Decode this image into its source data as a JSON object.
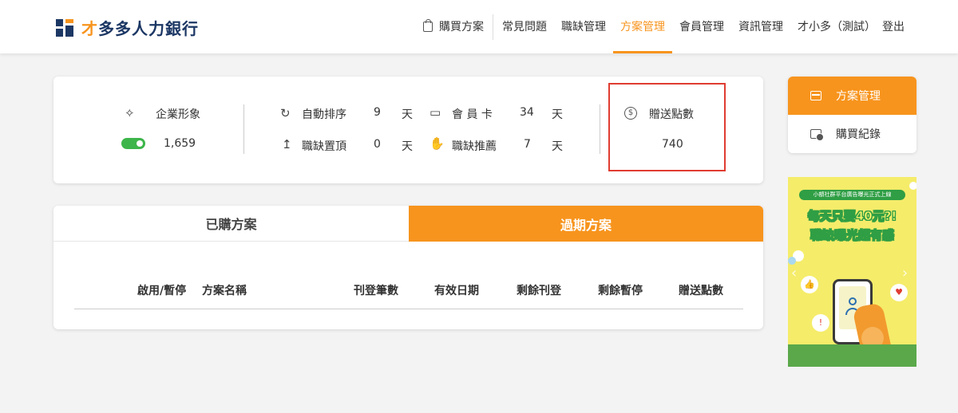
{
  "brand": {
    "logo_first": "才",
    "logo_rest": "多多人力銀行"
  },
  "nav": {
    "buy_plan": "購買方案",
    "faq": "常見問題",
    "jobs": "職缺管理",
    "plans": "方案管理",
    "members": "會員管理",
    "info": "資訊管理",
    "user": "才小多（測試）",
    "logout": "登出"
  },
  "stats": {
    "corporate_image_label": "企業形象",
    "corporate_image_value": "1,659",
    "auto_sort_label": "自動排序",
    "auto_sort_value": "9",
    "auto_sort_unit": "天",
    "member_card_label": "會 員 卡",
    "member_card_value": "34",
    "member_card_unit": "天",
    "job_top_label": "職缺置頂",
    "job_top_value": "0",
    "job_top_unit": "天",
    "job_recommend_label": "職缺推薦",
    "job_recommend_value": "7",
    "job_recommend_unit": "天",
    "bonus_points_label": "贈送點數",
    "bonus_points_value": "740"
  },
  "plan_tabs": {
    "owned": "已購方案",
    "expired": "過期方案"
  },
  "table": {
    "headers": [
      "啟用/暫停",
      "方案名稱",
      "刊登筆數",
      "有效日期",
      "剩餘刊登",
      "剩餘暫停",
      "贈送點數"
    ]
  },
  "sidebar": {
    "plan_management": "方案管理",
    "purchase_history": "購買紀錄"
  },
  "banner": {
    "top_text": "小額社群平台廣告曝光正式上線",
    "line1": "每天只要40元?!",
    "line2": "職缺曝光超有感"
  },
  "colors": {
    "accent": "#f7941d",
    "brand": "#1c3764",
    "toggle_on": "#3db54a",
    "highlight": "#e03c31"
  }
}
